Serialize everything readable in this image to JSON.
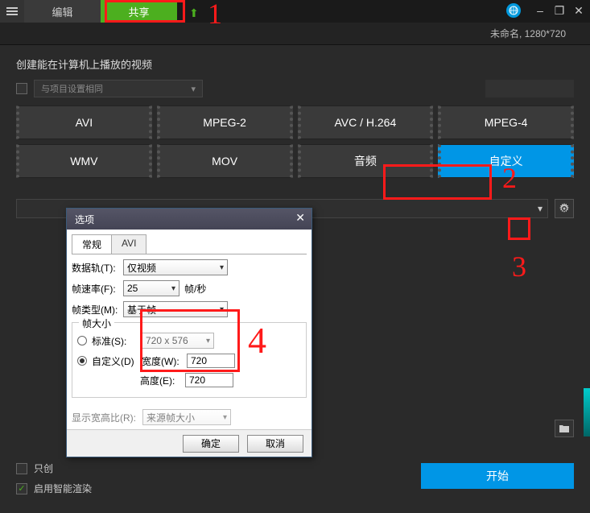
{
  "titlebar": {
    "tab_edit": "编辑",
    "tab_share": "共享"
  },
  "subtitle": "未命名, 1280*720",
  "main": {
    "heading": "创建能在计算机上播放的视频",
    "subset_label": "与项目设置相同",
    "formats": [
      "AVI",
      "MPEG-2",
      "AVC / H.264",
      "MPEG-4",
      "WMV",
      "MOV",
      "音频",
      "自定义"
    ],
    "start_label": "开始",
    "check_only_create": "只创",
    "check_smart_render": "启用智能渲染"
  },
  "dialog": {
    "title": "选项",
    "tab_general": "常规",
    "tab_avi": "AVI",
    "track_label": "数据轨(T):",
    "track_value": "仅视频",
    "framerate_label": "帧速率(F):",
    "framerate_value": "25",
    "framerate_unit": "帧/秒",
    "frametype_label": "帧类型(M):",
    "frametype_value": "基于帧",
    "framesize_legend": "帧大小",
    "standard_label": "标准(S):",
    "standard_value": "720 x 576",
    "custom_label": "自定义(D)",
    "width_label": "宽度(W):",
    "width_value": "720",
    "height_label": "高度(E):",
    "height_value": "720",
    "aspect_label": "显示宽高比(R):",
    "aspect_value": "来源帧大小",
    "ok": "确定",
    "cancel": "取消"
  },
  "annotations": {
    "n1": "1",
    "n2": "2",
    "n3": "3",
    "n4": "4"
  }
}
